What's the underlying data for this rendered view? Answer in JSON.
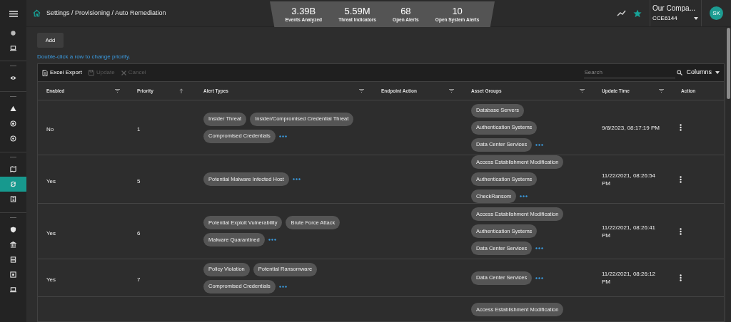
{
  "breadcrumb": "Settings / Provisioning / Auto Remediation",
  "stats": [
    {
      "value": "3.39B",
      "label": "Events Analyzed"
    },
    {
      "value": "5.59M",
      "label": "Threat Indicators"
    },
    {
      "value": "68",
      "label": "Open Alerts"
    },
    {
      "value": "10",
      "label": "Open System Alerts"
    }
  ],
  "account": {
    "company": "Our Compa...",
    "code": "CCE6144",
    "avatar": "SK"
  },
  "sidebar": {
    "groups": [
      {
        "items": [
          {
            "selected": false
          },
          {
            "selected": false
          }
        ]
      },
      {
        "items": [
          {
            "selected": false
          }
        ]
      },
      {
        "items": [
          {
            "selected": false
          },
          {
            "selected": false
          },
          {
            "selected": false
          }
        ]
      },
      {
        "items": [
          {
            "selected": false
          },
          {
            "selected": true
          },
          {
            "selected": false
          }
        ]
      },
      {
        "items": [
          {
            "selected": false
          },
          {
            "selected": false
          },
          {
            "selected": false
          },
          {
            "selected": false
          },
          {
            "selected": false
          }
        ]
      }
    ]
  },
  "add_button": "Add",
  "hint": "Double-click a row to change priority.",
  "toolbar": {
    "export": "Excel Export",
    "update": "Update",
    "cancel": "Cancel",
    "search_placeholder": "Search",
    "columns": "Columns"
  },
  "columns": [
    {
      "label": "Enabled",
      "kind": "filter"
    },
    {
      "label": "Priority",
      "kind": "sort"
    },
    {
      "label": "Alert Types",
      "kind": "filter"
    },
    {
      "label": "Endpoint Action",
      "kind": "filter"
    },
    {
      "label": "Asset Groups",
      "kind": "filter"
    },
    {
      "label": "Update Time",
      "kind": "filter"
    },
    {
      "label": "Action",
      "kind": "none"
    }
  ],
  "rows": [
    {
      "enabled": "No",
      "priority": "1",
      "alert_types": [
        "Insider Threat",
        "Insider/Compromised Credential Threat",
        "Compromised Credentials"
      ],
      "alert_types_more": true,
      "asset_groups": [
        "Database Servers",
        "Authentication Systems",
        "Data Center Services"
      ],
      "asset_groups_more": true,
      "update_time": "9/8/2023, 08:17:19 PM"
    },
    {
      "enabled": "Yes",
      "priority": "5",
      "alert_types": [
        "Potential Malware Infected Host"
      ],
      "alert_types_more": true,
      "asset_groups": [
        "Access Establishment Modification",
        "Authentication Systems",
        "CheckRansom"
      ],
      "asset_groups_more": true,
      "update_time": "11/22/2021, 08:26:54 PM"
    },
    {
      "enabled": "Yes",
      "priority": "6",
      "alert_types": [
        "Potential Exploit Vulnerability",
        "Brute Force Attack",
        "Malware Quarantined"
      ],
      "alert_types_more": true,
      "asset_groups": [
        "Access Establishment Modification",
        "Authentication Systems",
        "Data Center Services"
      ],
      "asset_groups_more": true,
      "update_time": "11/22/2021, 08:26:41 PM"
    },
    {
      "enabled": "Yes",
      "priority": "7",
      "alert_types": [
        "Policy Violation",
        "Potential Ransomware",
        "Compromised Credentials"
      ],
      "alert_types_more": true,
      "asset_groups": [
        "Data Center Services"
      ],
      "asset_groups_more": true,
      "update_time": "11/22/2021, 08:26:12 PM"
    },
    {
      "asset_groups": [
        "Access Establishment Modification"
      ]
    }
  ]
}
